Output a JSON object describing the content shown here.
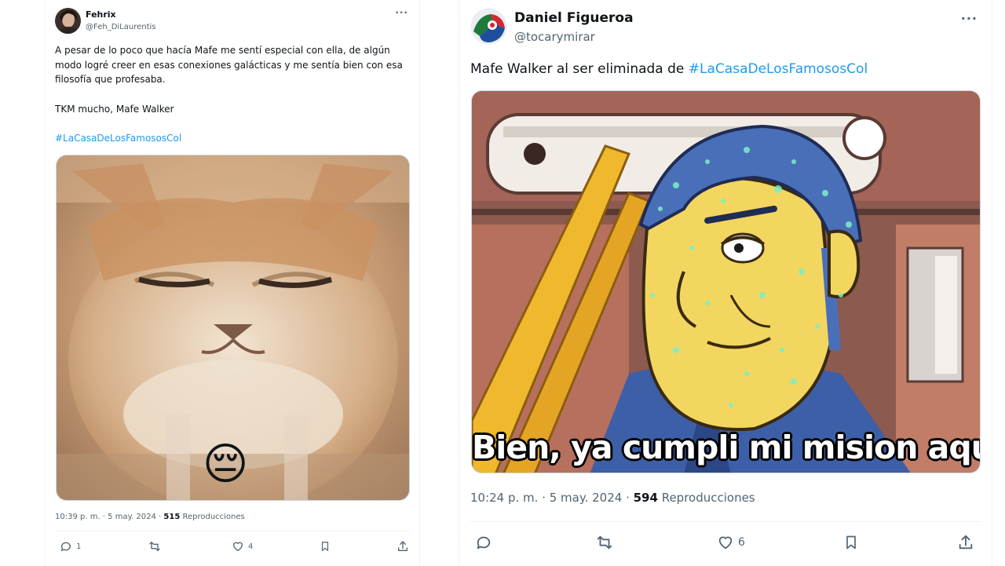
{
  "left_tweet": {
    "author": {
      "display_name": "Fehrix",
      "handle": "@Feh_DiLaurentis"
    },
    "more_label": "···",
    "text_lines": [
      "A pesar de lo poco que hacía Mafe me sentí especial con ella, de algún modo logré creer en esas conexiones galácticas y me sentía bien con esa filosofía que profesaba.",
      "TKM mucho, Mafe Walker"
    ],
    "hashtag": "#LaCasaDeLosFamososCol",
    "media": {
      "description": "sad-cat-meme",
      "emoji": "😔"
    },
    "timestamp": "10:39 p. m. · 5 may. 2024 · ",
    "views_count": "515",
    "views_label": " Reproducciones",
    "actions": {
      "reply_count": "1",
      "retweet_count": "",
      "like_count": "4"
    }
  },
  "right_tweet": {
    "author": {
      "display_name": "Daniel Figueroa",
      "handle": "@tocarymirar"
    },
    "more_label": "···",
    "text_prefix": "Mafe Walker al ser eliminada de ",
    "hashtag": "#LaCasaDeLosFamososCol",
    "media": {
      "caption": "Bien, ya cumpli mi mision aqui"
    },
    "timestamp": "10:24 p. m. · 5 may. 2024 · ",
    "views_count": "594",
    "views_label": " Reproducciones",
    "actions": {
      "reply_count": "",
      "retweet_count": "",
      "like_count": "6"
    }
  },
  "colors": {
    "link": "#1d9bf0",
    "secondary_text": "#536471",
    "primary_text": "#0f1419",
    "border": "#eff3f4"
  }
}
